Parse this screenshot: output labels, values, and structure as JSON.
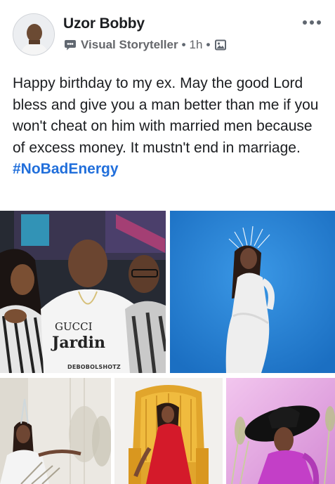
{
  "post": {
    "author_name": "Uzor Bobby",
    "role": "Visual Storyteller",
    "separator": "•",
    "time": "1h",
    "body_text": "Happy birthday to my ex. May the good Lord bless and give you a man better than me if you won't cheat on him with married men because of excess money. It mustn't end in marriage.",
    "hashtag": "#NoBadEnergy"
  },
  "photos": [
    {
      "name": "group-photo",
      "shirt_text_line1": "GUCCI",
      "shirt_text_line2": "Jardin",
      "watermark": "DEBOBOLSHOTZ"
    },
    {
      "name": "white-outfit-photo"
    },
    {
      "name": "tiara-photo"
    },
    {
      "name": "red-dress-chair-photo"
    },
    {
      "name": "black-hat-photo"
    }
  ],
  "icons": {
    "badge": "visual-storyteller-badge-icon",
    "audience": "photo-audience-icon",
    "more": "more-options-icon"
  },
  "colors": {
    "hashtag": "#216fdb",
    "text": "#1c1e21",
    "meta": "#65676b"
  }
}
